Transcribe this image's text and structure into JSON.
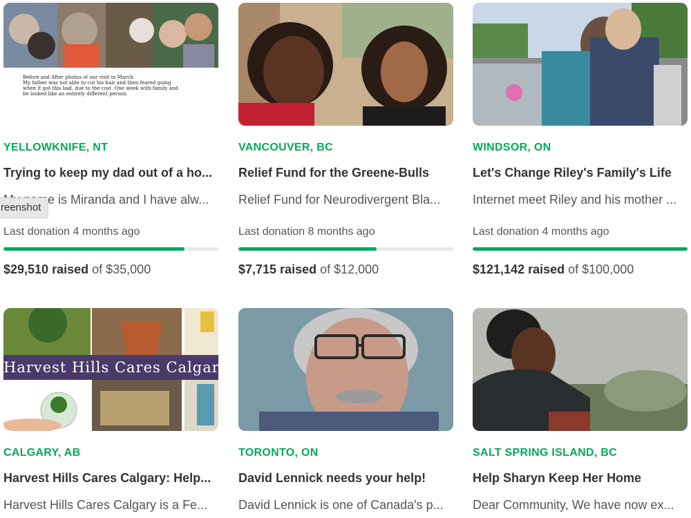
{
  "tooltip": "reenshot",
  "cards": [
    {
      "location": "YELLOWKNIFE, NT",
      "title": "Trying to keep my dad out of a ho...",
      "description": "My name is Miranda and I have alw...",
      "last_donation": "Last donation 4 months ago",
      "progress": 0.843,
      "raised": "$29,510 raised",
      "goal": "of $35,000",
      "image_caption": "Before and After photos of our visit in March.\nMy father was not able to cut his hair and then feared going\nwhen it got this bad, due to the cost. One week with family and\nhe looked like an entirely different person."
    },
    {
      "location": "VANCOUVER, BC",
      "title": "Relief Fund for the Greene-Bulls",
      "description": "Relief Fund for Neurodivergent Bla...",
      "last_donation": "Last donation 8 months ago",
      "progress": 0.643,
      "raised": "$7,715 raised",
      "goal": "of $12,000"
    },
    {
      "location": "WINDSOR, ON",
      "title": "Let's Change Riley's Family's Life",
      "description": "Internet meet Riley and his mother ...",
      "last_donation": "Last donation 4 months ago",
      "progress": 1.0,
      "raised": "$121,142 raised",
      "goal": "of $100,000"
    },
    {
      "location": "CALGARY, AB",
      "title": "Harvest Hills Cares Calgary: Help...",
      "description": "Harvest Hills Cares Calgary is a Fe...",
      "image_banner": "Harvest Hills Cares Calgary"
    },
    {
      "location": "TORONTO, ON",
      "title": "David Lennick needs your help!",
      "description": "David Lennick is one of Canada's p..."
    },
    {
      "location": "SALT SPRING ISLAND, BC",
      "title": "Help Sharyn Keep Her Home",
      "description": "Dear Community, We have now ex..."
    }
  ]
}
